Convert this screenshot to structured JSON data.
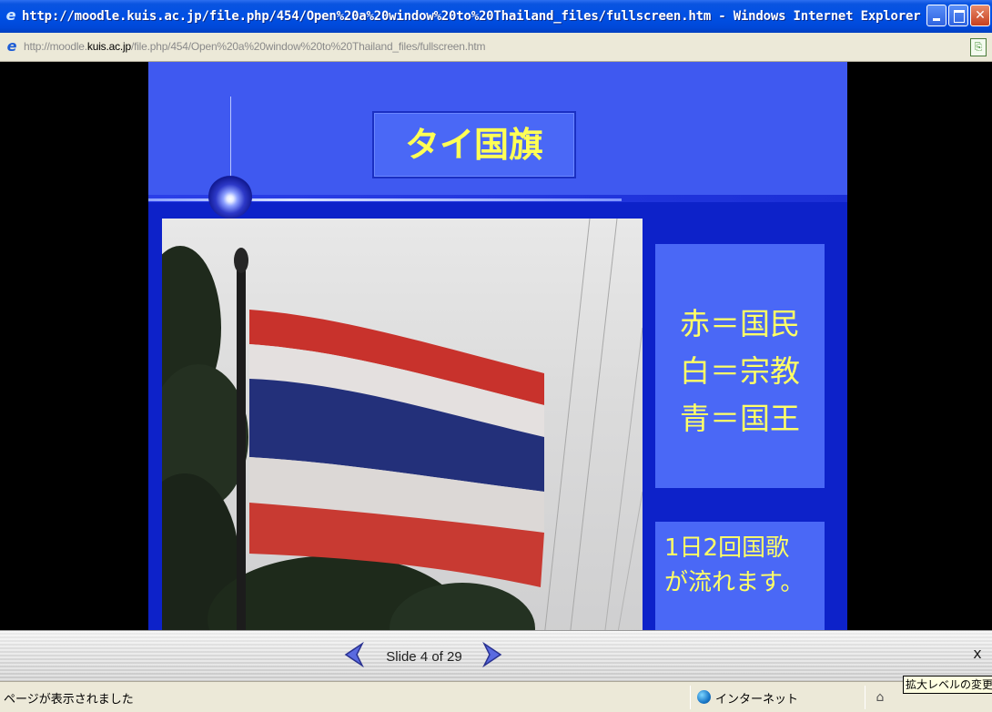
{
  "window": {
    "title": "http://moodle.kuis.ac.jp/file.php/454/Open%20a%20window%20to%20Thailand_files/fullscreen.htm - Windows Internet Explorer"
  },
  "address": {
    "url_prefix": "http://moodle.",
    "url_domain": "kuis.ac.jp",
    "url_path": "/file.php/454/Open%20a%20window%20to%20Thailand_files/fullscreen.htm"
  },
  "slide": {
    "title": "タイ国旗",
    "panel1_lines": [
      "赤＝国民",
      "白＝宗教",
      "青＝国王"
    ],
    "panel2_lines": [
      "1日2回国歌",
      "が流れます。"
    ],
    "colors": {
      "background": "#0d22c9",
      "header": "#3f59f0",
      "panel": "#4a68f6",
      "text": "#ffff66"
    }
  },
  "nav": {
    "counter": "Slide 4 of 29",
    "close": "x"
  },
  "status": {
    "message": "ページが表示されました",
    "zone": "インターネット",
    "zoom_tooltip": "拡大レベルの変更"
  }
}
